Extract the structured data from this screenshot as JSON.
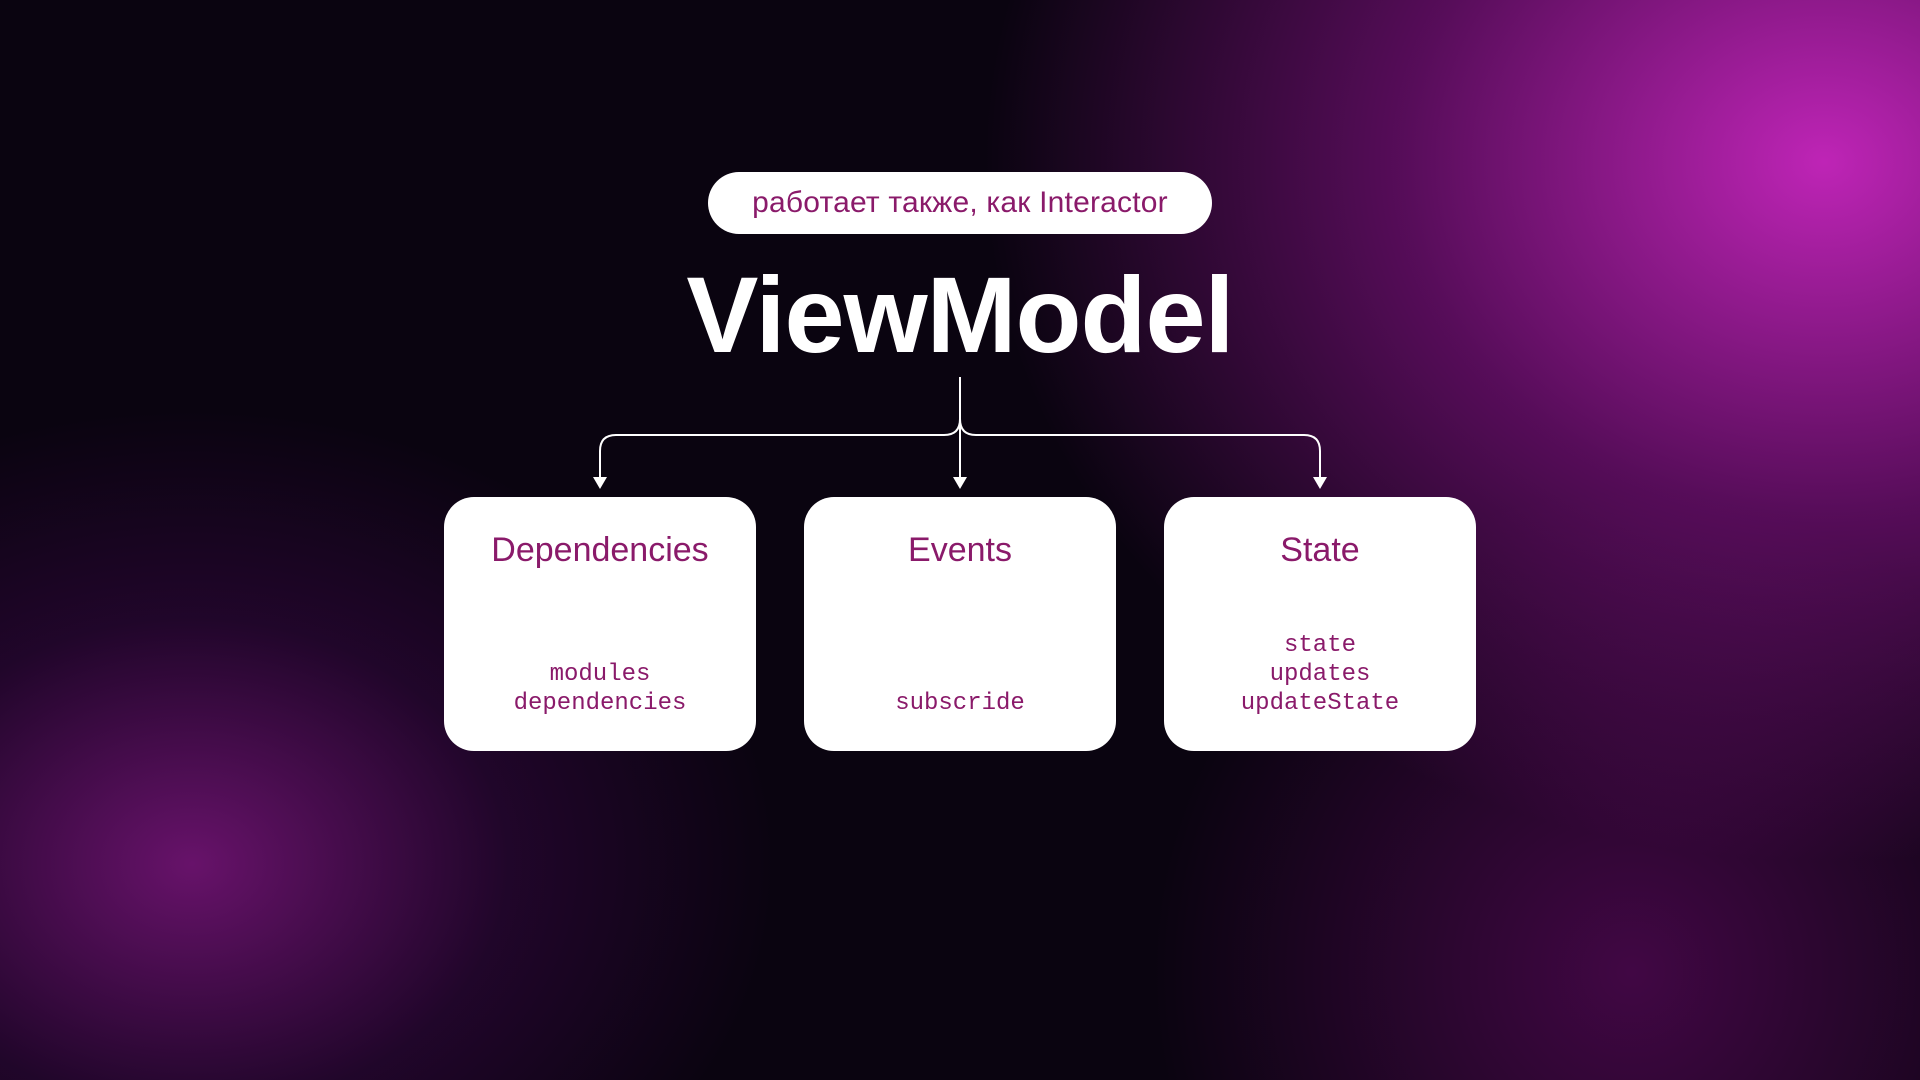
{
  "badge": {
    "text": "работает также, как Interactor"
  },
  "title": "ViewModel",
  "cards": [
    {
      "title": "Dependencies",
      "items": [
        "modules",
        "dependencies"
      ]
    },
    {
      "title": "Events",
      "items": [
        "subscride"
      ]
    },
    {
      "title": "State",
      "items": [
        "state",
        "updates",
        "updateState"
      ]
    }
  ],
  "colors": {
    "accent": "#8a1a6a",
    "fg": "#ffffff"
  }
}
